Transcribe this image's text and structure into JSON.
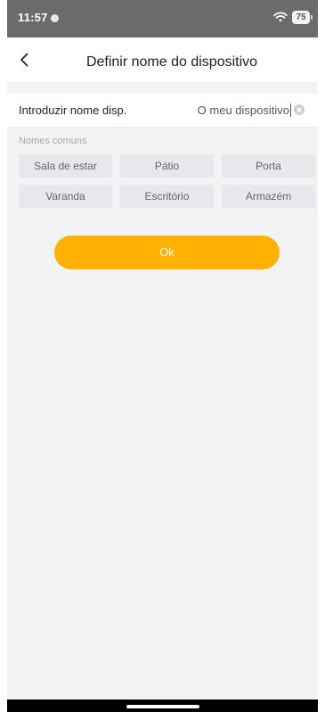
{
  "status_bar": {
    "time": "11:57",
    "battery": "75"
  },
  "header": {
    "title": "Definir nome do dispositivo",
    "back_icon": "chevron-left-icon"
  },
  "name_input": {
    "label": "Introduzir nome disp.",
    "value": "O meu dispositivo",
    "clear_icon": "clear-circle-icon"
  },
  "common_names": {
    "label": "Nomes comuns",
    "items": [
      "Sala de estar",
      "Pátio",
      "Porta",
      "Varanda",
      "Escritório",
      "Armazém"
    ]
  },
  "ok_button": {
    "label": "Ok"
  },
  "colors": {
    "accent": "#ffb000",
    "background": "#f2f3f5",
    "chip_background": "#e7e8eb",
    "status_bar": "#6b6b6b"
  }
}
